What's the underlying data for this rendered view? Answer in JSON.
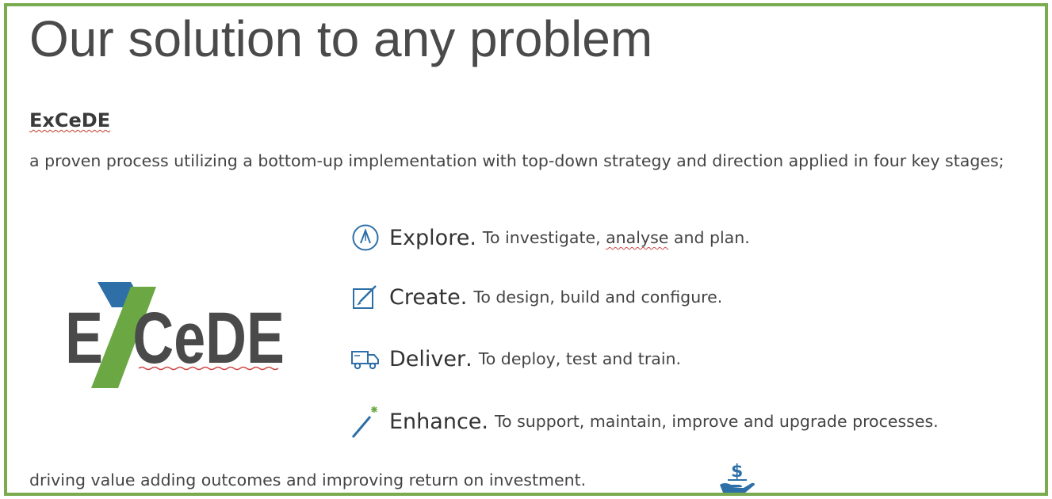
{
  "slide": {
    "title": "Our solution to any problem",
    "brand_heading": "ExCeDE",
    "intro": "a proven process utilizing a bottom-up implementation with top-down strategy and direction applied in four key stages;",
    "logo_text": "EXCeDE",
    "stages": [
      {
        "name": "Explore",
        "desc_before": "To investigate, ",
        "desc_mark": "analyse",
        "desc_after": " and plan.",
        "icon": "compass-icon"
      },
      {
        "name": "Create",
        "desc": "To design, build and configure.",
        "icon": "edit-icon"
      },
      {
        "name": "Deliver",
        "desc": "To deploy, test and train.",
        "icon": "truck-icon"
      },
      {
        "name": "Enhance",
        "desc": "To support, maintain, improve and upgrade processes.",
        "icon": "magic-wand-icon"
      }
    ],
    "outro": "driving value adding outcomes and improving return on investment.",
    "outro_icon": "money-hand-icon"
  },
  "colors": {
    "frame_border": "#7aab4e",
    "accent_blue": "#2e6fa8",
    "logo_green": "#6ba844",
    "logo_text": "#4a4a4a",
    "spell_underline": "#d04a4a"
  }
}
